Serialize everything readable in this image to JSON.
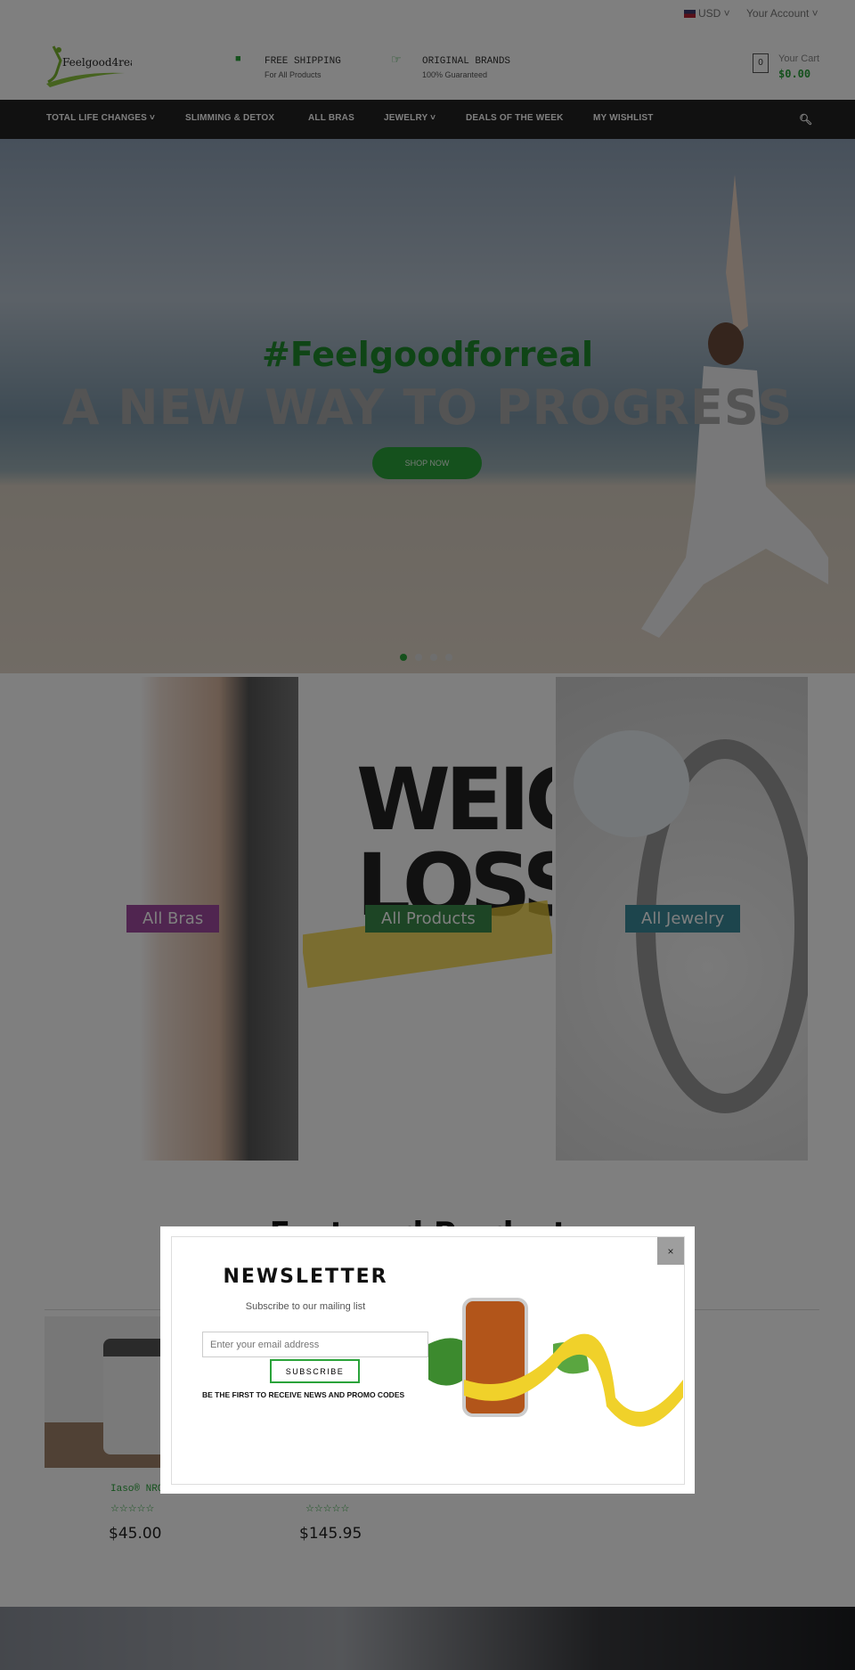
{
  "topbar": {
    "currency": "USD",
    "account": "Your Account"
  },
  "header": {
    "logo_text": "Feelgood4real",
    "features": [
      {
        "title": "FREE SHIPPING",
        "sub": "For All Products",
        "icon": "truck-icon"
      },
      {
        "title": "ORIGINAL BRANDS",
        "sub": "100% Guaranteed",
        "icon": "thumbs-up-icon"
      }
    ],
    "cart": {
      "label": "Your Cart",
      "total": "$0.00",
      "count": "0"
    }
  },
  "nav": {
    "items": [
      "TOTAL LIFE CHANGES",
      "SLIMMING & DETOX",
      "ALL BRAS",
      "JEWELRY",
      "DEALS OF THE WEEK",
      "MY WISHLIST"
    ]
  },
  "hero": {
    "hashtag": "#Feelgoodforreal",
    "headline": "A NEW WAY TO PROGRESS",
    "button": "SHOP NOW",
    "slides": 4,
    "active_slide": 1
  },
  "categories": [
    {
      "label": "All Bras",
      "color": "#a04aa0"
    },
    {
      "label": "All Products",
      "color": "#3a8a4a"
    },
    {
      "label": "All Jewelry",
      "color": "#3a8a9a"
    }
  ],
  "featured": {
    "title": "Featured Products",
    "products": [
      {
        "name": "Iaso® NRG",
        "price": "$45.00",
        "rating": 0
      },
      {
        "name": "",
        "price": "$145.95",
        "rating": 0
      }
    ]
  },
  "popup": {
    "title": "NEWSLETTER",
    "subtitle": "Subscribe to our mailing list",
    "placeholder": "Enter your email address",
    "button": "SUBSCRIBE",
    "note": "BE THE FIRST TO RECEIVE NEWS AND PROMO CODES",
    "close": "×"
  },
  "colors": {
    "accent": "#2aa33a",
    "nav_bg": "#222222"
  }
}
